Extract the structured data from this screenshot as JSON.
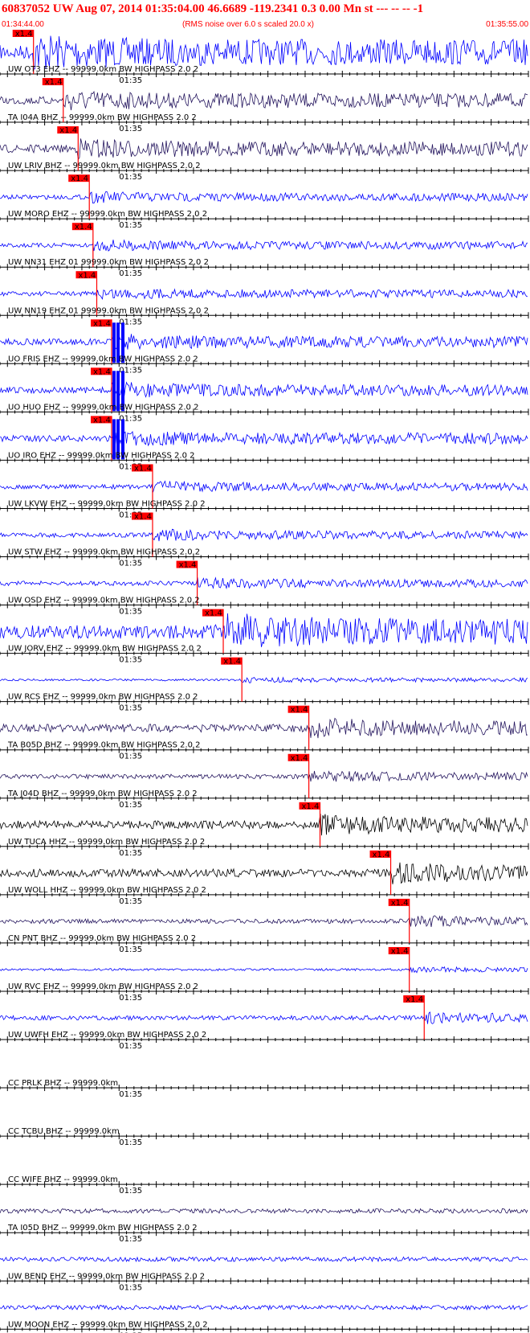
{
  "header": {
    "title": "60837052 UW Aug 07, 2014 01:35:04.00   46.6689 -119.2341  0.3 0.00 Mn st --- -- --  -1",
    "start_time": "01:34:44.00",
    "subtitle": "(RMS noise over 6.0 s scaled 20.0 x)",
    "end_time": "01:35:55.00"
  },
  "colors": {
    "header": "#ff0000",
    "pick_box": "#ff0000",
    "blue": "#0000ff",
    "navy": "#24155e",
    "black": "#000000",
    "axis": "#000000"
  },
  "chart_data": {
    "type": "line",
    "x_axis": {
      "unit": "time",
      "start": "01:34:44.00",
      "end": "01:35:55.00",
      "tick_label": "01:35"
    },
    "pick_label": "x1.4",
    "traces": [
      {
        "label": "UW OT3 EHZ -- 99999.0km BW  HIGHPASS  2.0  2",
        "color": "blue",
        "pick_time": "01:34:48.5",
        "amplitude": "high"
      },
      {
        "label": "TA I04A BHZ -- 99999.0km BW  HIGHPASS  2.0  2",
        "color": "navy",
        "pick_time": "01:34:52.5",
        "amplitude": "medium"
      },
      {
        "label": "UW LRIV BHZ -- 99999.0km BW  HIGHPASS  2.0  2",
        "color": "navy",
        "pick_time": "01:34:54.5",
        "amplitude": "medium"
      },
      {
        "label": "UW MORO EHZ -- 99999.0km BW  HIGHPASS  2.0  2",
        "color": "blue",
        "pick_time": "01:34:56.0",
        "amplitude": "low"
      },
      {
        "label": "UW NN31 EHZ 01 99999.0km BW  HIGHPASS  2.0  2",
        "color": "blue",
        "pick_time": "01:34:56.5",
        "amplitude": "low"
      },
      {
        "label": "UW NN19 EHZ 01 99999.0km BW  HIGHPASS  2.0  2",
        "color": "blue",
        "pick_time": "01:34:57.0",
        "amplitude": "low"
      },
      {
        "label": "UO FRIS EHZ -- 99999.0km BW  HIGHPASS  2.0  2",
        "color": "blue",
        "pick_time": "01:34:59.0",
        "amplitude": "clipped"
      },
      {
        "label": "UO HUO EHZ -- 99999.0km BW  HIGHPASS  2.0  2",
        "color": "blue",
        "pick_time": "01:34:59.0",
        "amplitude": "clipped"
      },
      {
        "label": "UO IRO EHZ -- 99999.0km BW  HIGHPASS  2.0  2",
        "color": "blue",
        "pick_time": "01:34:59.0",
        "amplitude": "clipped"
      },
      {
        "label": "UW LKVW EHZ -- 99999.0km BW  HIGHPASS  2.0  2",
        "color": "blue",
        "pick_time": "01:35:04.5",
        "amplitude": "low"
      },
      {
        "label": "UW STW EHZ -- 99999.0km BW  HIGHPASS  2.0  2",
        "color": "blue",
        "pick_time": "01:35:04.5",
        "amplitude": "low"
      },
      {
        "label": "UW OSD EHZ -- 99999.0km BW  HIGHPASS  2.0  2",
        "color": "blue",
        "pick_time": "01:35:10.5",
        "amplitude": "low"
      },
      {
        "label": "UW JORV EHZ -- 99999.0km BW  HIGHPASS  2.0  2",
        "color": "blue",
        "pick_time": "01:35:14.0",
        "amplitude": "high"
      },
      {
        "label": "UW RCS EHZ -- 99999.0km BW  HIGHPASS  2.0  2",
        "color": "blue",
        "pick_time": "01:35:16.5",
        "amplitude": "quiet"
      },
      {
        "label": "TA B05D BHZ -- 99999.0km BW  HIGHPASS  2.0  2",
        "color": "navy",
        "pick_time": "01:35:25.5",
        "amplitude": "medium"
      },
      {
        "label": "TA J04D BHZ -- 99999.0km BW  HIGHPASS  2.0  2",
        "color": "navy",
        "pick_time": "01:35:25.5",
        "amplitude": "low"
      },
      {
        "label": "UW TUCA HHZ -- 99999.0km BW  HIGHPASS  2.0  2",
        "color": "black",
        "pick_time": "01:35:27.0",
        "amplitude": "medium"
      },
      {
        "label": "UW WOLL HHZ -- 99999.0km BW  HIGHPASS  2.0  2",
        "color": "black",
        "pick_time": "01:35:36.5",
        "amplitude": "medium"
      },
      {
        "label": "CN PNT BHZ -- 99999.0km BW  HIGHPASS  2.0  2",
        "color": "navy",
        "pick_time": "01:35:39.0",
        "amplitude": "low"
      },
      {
        "label": "UW RVC EHZ -- 99999.0km BW  HIGHPASS  2.0  2",
        "color": "blue",
        "pick_time": "01:35:39.0",
        "amplitude": "quiet"
      },
      {
        "label": "UW UWFH EHZ -- 99999.0km BW  HIGHPASS  2.0  2",
        "color": "blue",
        "pick_time": "01:35:41.0",
        "amplitude": "low"
      },
      {
        "label": "CC PRLK BHZ -- 99999.0km",
        "color": "none",
        "pick_time": "",
        "amplitude": "none"
      },
      {
        "label": "CC TCBU BHZ -- 99999.0km",
        "color": "none",
        "pick_time": "",
        "amplitude": "none"
      },
      {
        "label": "CC WIFE BHZ -- 99999.0km",
        "color": "none",
        "pick_time": "",
        "amplitude": "none"
      },
      {
        "label": "TA I05D BHZ -- 99999.0km BW  HIGHPASS  2.0  2",
        "color": "navy",
        "pick_time": "",
        "amplitude": "low"
      },
      {
        "label": "UW BEND EHZ -- 99999.0km BW  HIGHPASS  2.0  2",
        "color": "blue",
        "pick_time": "",
        "amplitude": "low"
      },
      {
        "label": "UW MOON EHZ -- 99999.0km BW  HIGHPASS  2.0  2",
        "color": "blue",
        "pick_time": "",
        "amplitude": "low"
      }
    ]
  }
}
